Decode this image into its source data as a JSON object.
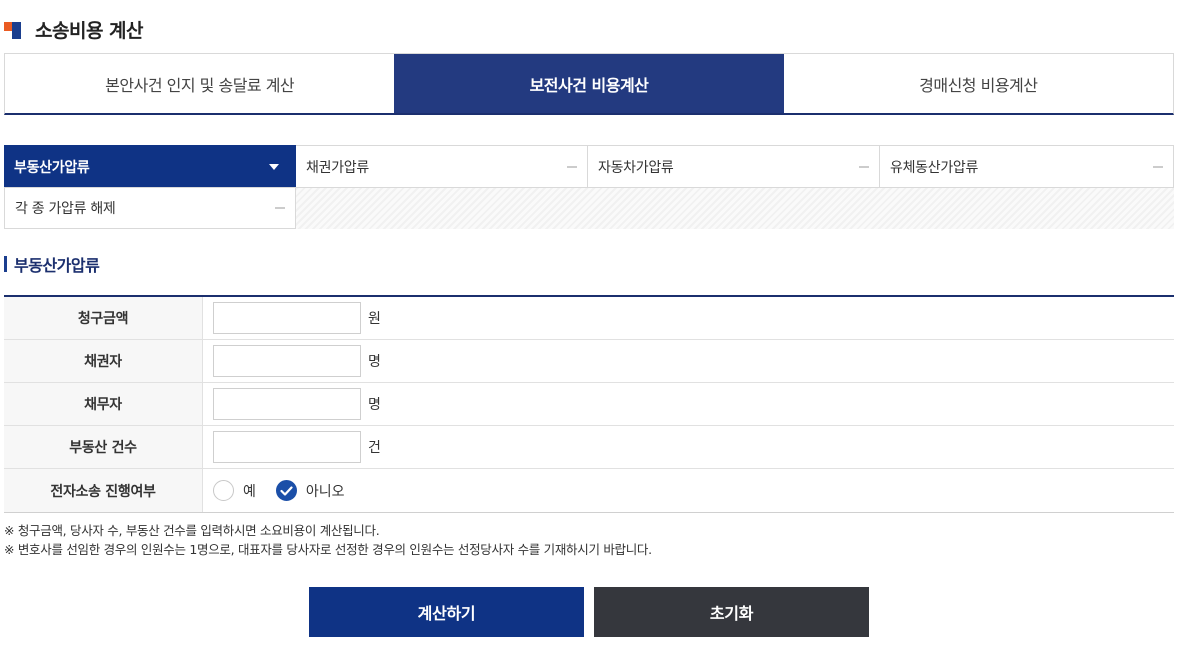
{
  "page": {
    "title": "소송비용 계산"
  },
  "main_tabs": [
    {
      "label": "본안사건 인지 및 송달료 계산",
      "active": false
    },
    {
      "label": "보전사건 비용계산",
      "active": true
    },
    {
      "label": "경매신청 비용계산",
      "active": false
    }
  ],
  "sub_tabs": [
    {
      "label": "부동산가압류",
      "active": true,
      "icon": "caret-down-icon"
    },
    {
      "label": "채권가압류",
      "active": false,
      "icon": "dash-icon"
    },
    {
      "label": "자동차가압류",
      "active": false,
      "icon": "dash-icon"
    },
    {
      "label": "유체동산가압류",
      "active": false,
      "icon": "dash-icon"
    },
    {
      "label": "각 종 가압류 해제",
      "active": false,
      "icon": "dash-icon"
    }
  ],
  "section": {
    "title": "부동산가압류"
  },
  "form": {
    "rows": [
      {
        "label": "청구금액",
        "value": "",
        "unit": "원"
      },
      {
        "label": "채권자",
        "value": "",
        "unit": "명"
      },
      {
        "label": "채무자",
        "value": "",
        "unit": "명"
      },
      {
        "label": "부동산 건수",
        "value": "",
        "unit": "건"
      }
    ],
    "e_litigation": {
      "label": "전자소송 진행여부",
      "options": [
        {
          "label": "예",
          "checked": false
        },
        {
          "label": "아니오",
          "checked": true
        }
      ]
    }
  },
  "notes": [
    "※  청구금액, 당사자 수, 부동산 건수를 입력하시면 소요비용이 계산됩니다.",
    "※  변호사를 선임한 경우의 인원수는 1명으로, 대표자를 당사자로 선정한 경우의 인원수는 선정당사자 수를 기재하시기 바랍니다."
  ],
  "buttons": {
    "calculate": "계산하기",
    "reset": "초기화"
  },
  "colors": {
    "primary": "#0f3385",
    "tab_active": "#233a80",
    "accent_orange": "#ea5b22",
    "dark_button": "#35373d"
  }
}
